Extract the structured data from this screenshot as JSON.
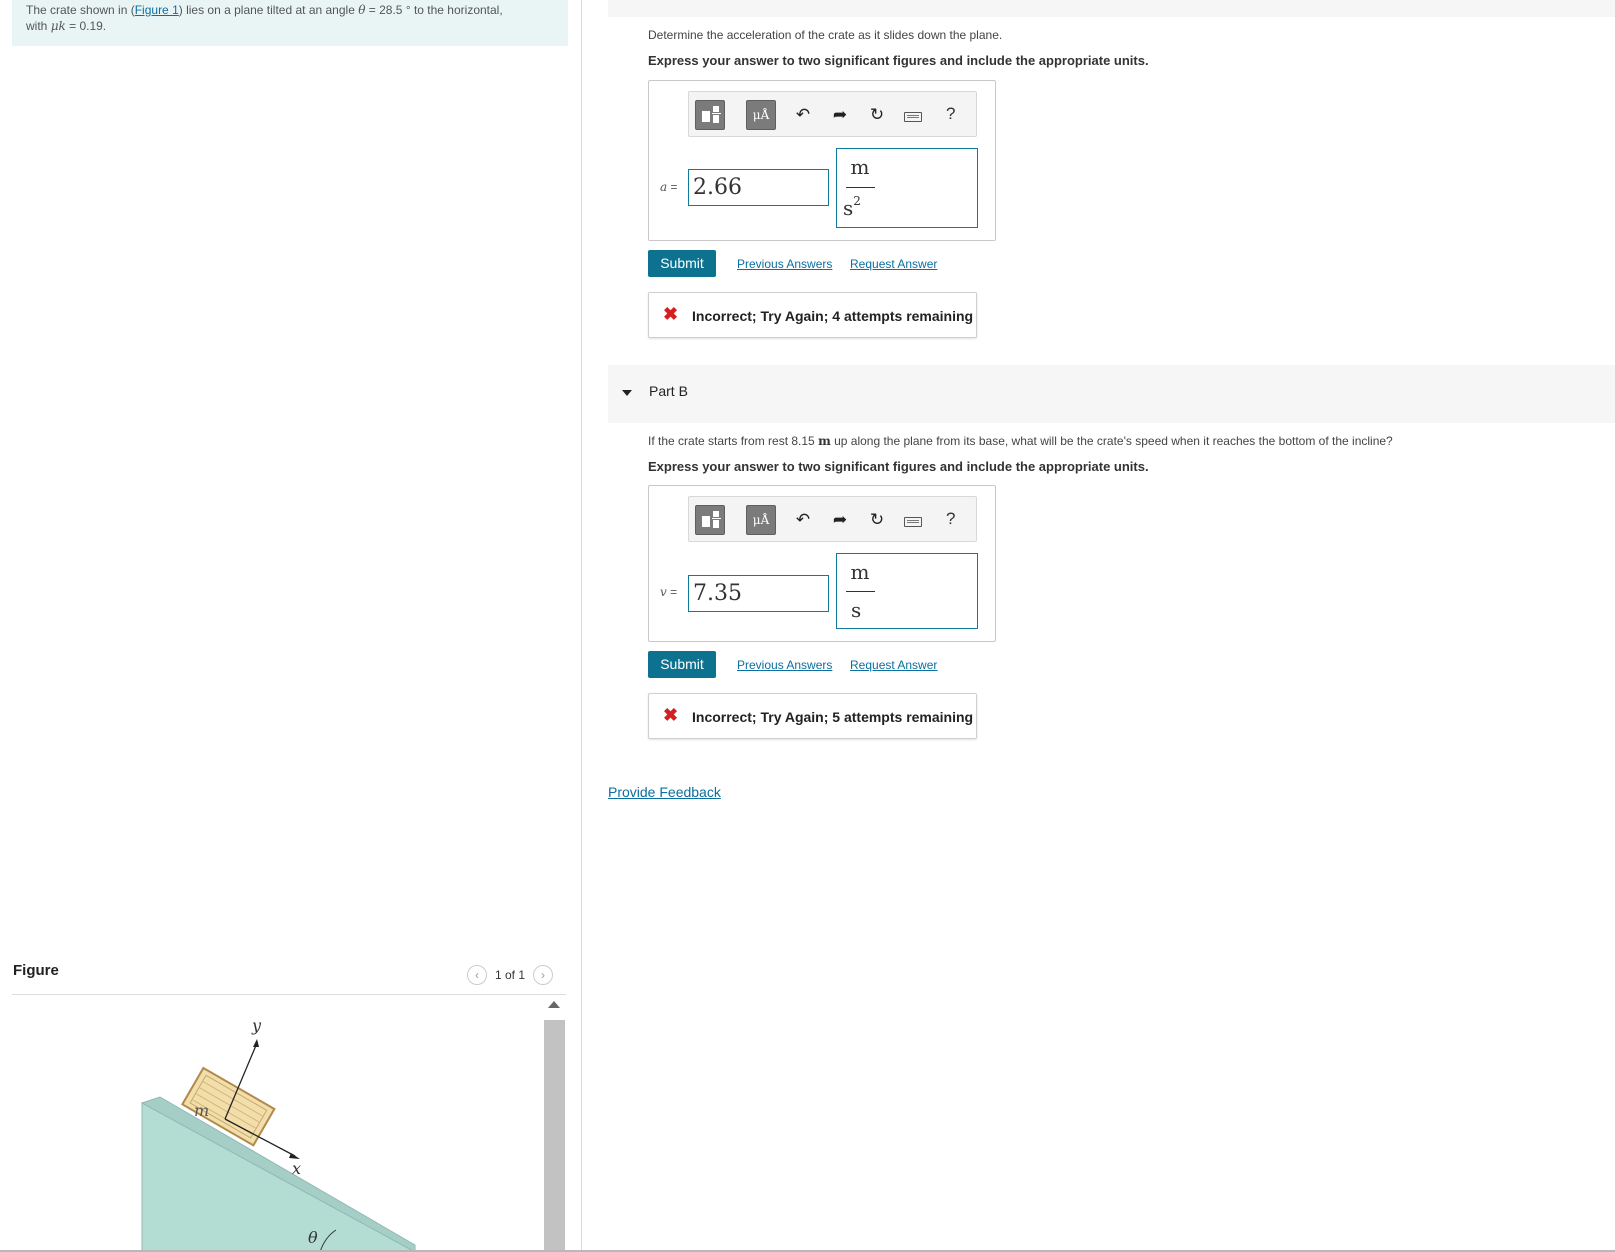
{
  "problem": {
    "text_before_link": "The crate shown in (",
    "link_text": "Figure 1",
    "text_after_link": ") lies on a plane tilted at an angle ",
    "theta_symbol": "θ",
    "theta_value": " = 28.5 ° to the horizontal,",
    "line2_prefix": "with ",
    "mu_symbol": "μk",
    "mu_value": " = 0.19."
  },
  "figure": {
    "header": "Figure",
    "counter": "1 of 1",
    "prev_icon": "chevron-left-icon",
    "next_icon": "chevron-right-icon",
    "labels": {
      "y": "y",
      "x": "x",
      "m": "m",
      "theta": "θ"
    },
    "colors": {
      "incline": "#b3ddd2",
      "incline_edge": "#8fb9b3",
      "crate": "#f2deab",
      "crate_edge": "#b08a4a"
    }
  },
  "part_a": {
    "question": "Determine the acceleration of the crate as it slides down the plane.",
    "instruction": "Express your answer to two significant figures and include the appropriate units.",
    "variable": "a",
    "equals": " =",
    "value": "2.66",
    "unit_numerator": "m",
    "unit_denominator": "s",
    "unit_exponent": "2",
    "toolbar": {
      "units_label": "μÅ",
      "help": "?"
    },
    "submit": "Submit",
    "previous_answers": "Previous Answers",
    "request_answer": "Request Answer",
    "feedback": "Incorrect; Try Again; 4 attempts remaining"
  },
  "part_b": {
    "title": "Part B",
    "question_before": "If the crate starts from rest 8.15 ",
    "question_unit": "m",
    "question_after": " up along the plane from its base, what will be the crate's speed when it reaches the bottom of the incline?",
    "instruction": "Express your answer to two significant figures and include the appropriate units.",
    "variable": "v",
    "equals": " =",
    "value": "7.35",
    "unit_numerator": "m",
    "unit_denominator": "s",
    "toolbar": {
      "units_label": "μÅ",
      "help": "?"
    },
    "submit": "Submit",
    "previous_answers": "Previous Answers",
    "request_answer": "Request Answer",
    "feedback": "Incorrect; Try Again; 5 attempts remaining"
  },
  "provide_feedback": "Provide Feedback",
  "colors": {
    "accent": "#0c7290",
    "link": "#0b6fa0",
    "error": "#d31f1f",
    "problem_bg": "#e9f5f5"
  }
}
